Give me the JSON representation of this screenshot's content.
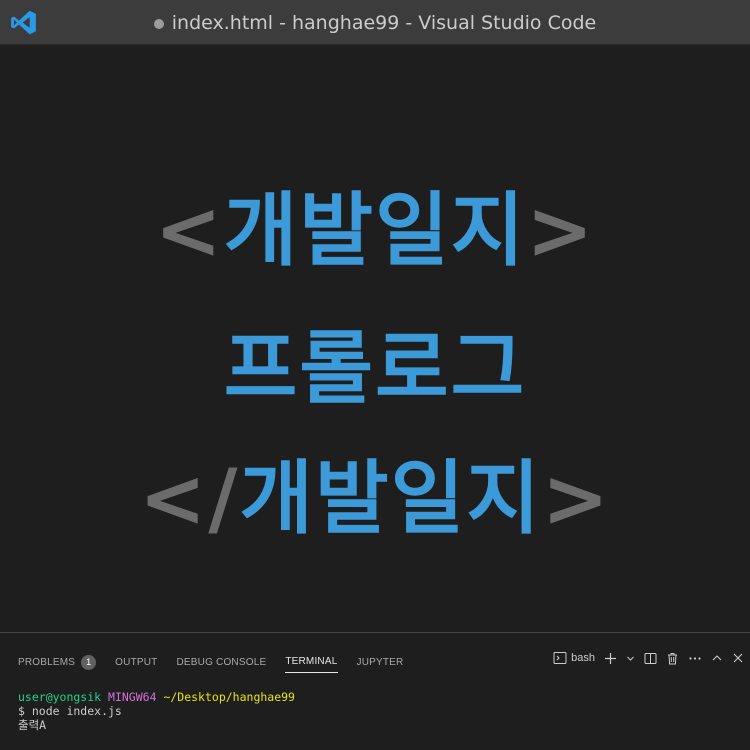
{
  "window": {
    "title": "index.html - hanghae99 - Visual Studio Code",
    "accent": "#3c9ad8"
  },
  "editor": {
    "line1": {
      "open": "<",
      "word": "개발일지",
      "close": ">"
    },
    "line2": {
      "word": "프롤로그"
    },
    "line3": {
      "open": "</",
      "word": "개발일지",
      "close": ">"
    }
  },
  "panel": {
    "tabs": [
      {
        "label": "PROBLEMS",
        "badge": "1"
      },
      {
        "label": "OUTPUT"
      },
      {
        "label": "DEBUG CONSOLE"
      },
      {
        "label": "TERMINAL",
        "active": true
      },
      {
        "label": "JUPYTER"
      }
    ],
    "shell_label": "bash",
    "icons": [
      "terminal-icon",
      "plus-icon",
      "chevron-down-icon",
      "split-icon",
      "trash-icon",
      "more-icon",
      "maximize-icon",
      "close-icon"
    ]
  },
  "terminal": {
    "user": "user@yongsik",
    "host": "MINGW64",
    "path": "~/Desktop/hanghae99",
    "command": "$ node index.js",
    "output": "출력A"
  }
}
